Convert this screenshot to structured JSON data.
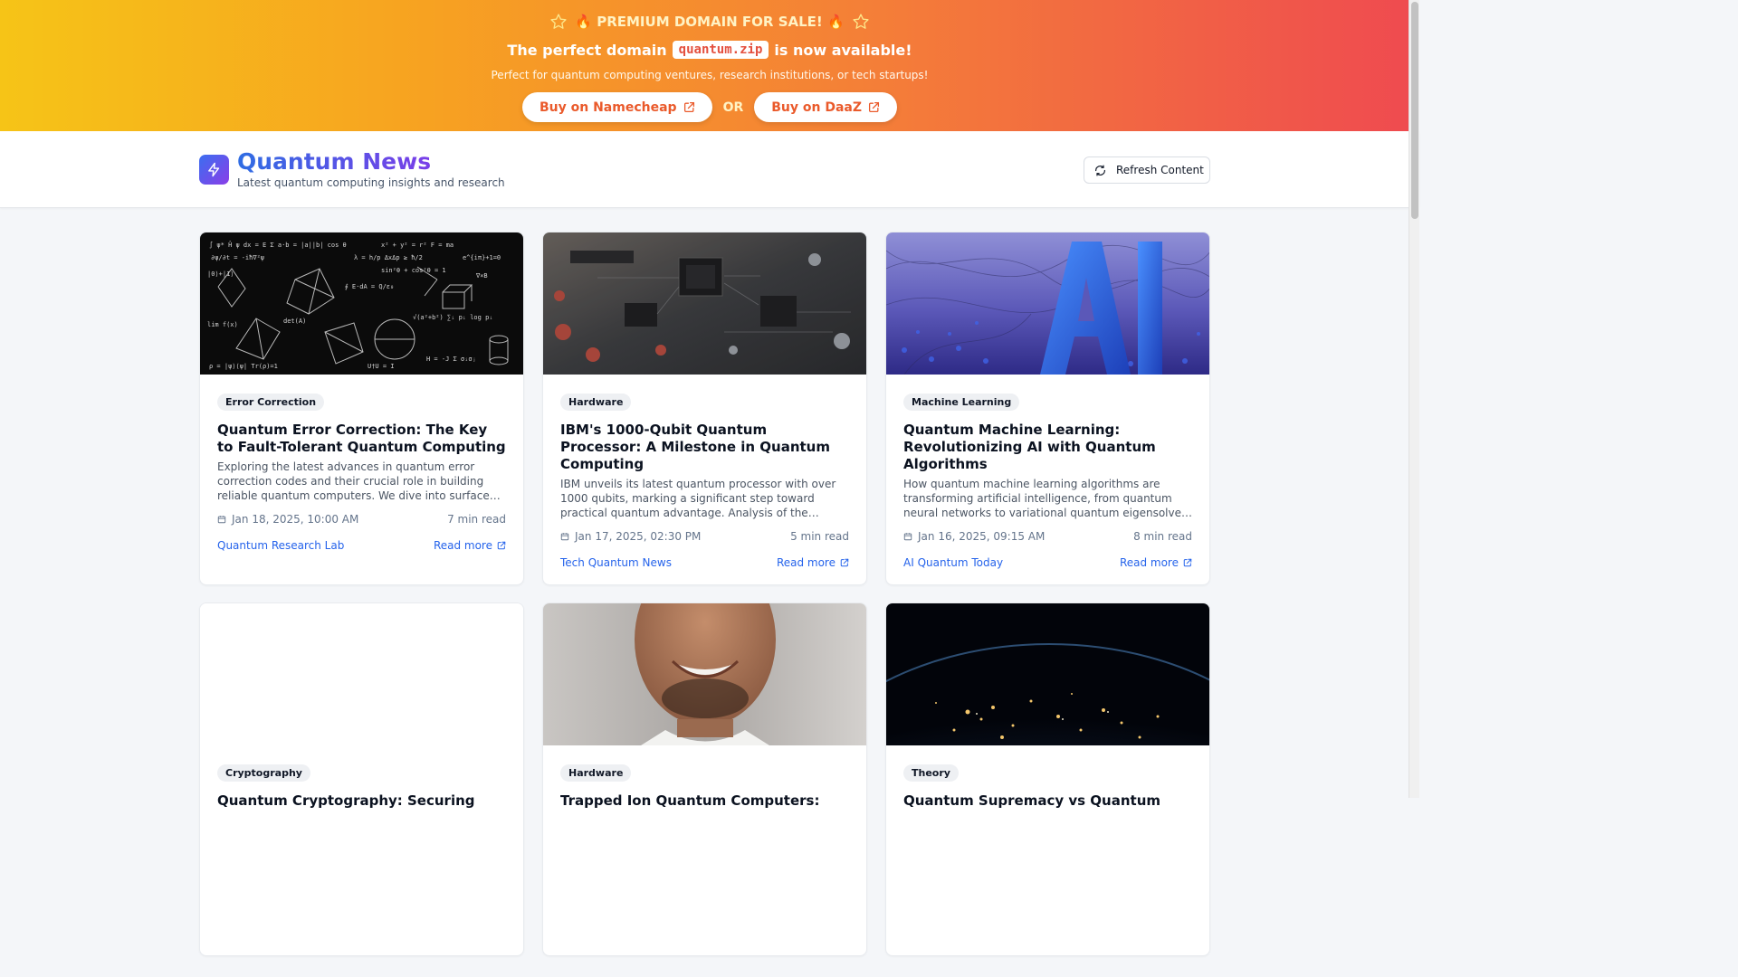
{
  "banner": {
    "title": "🔥 PREMIUM DOMAIN FOR SALE! 🔥",
    "subtitle_pre": "The perfect domain",
    "domain": "quantum.zip",
    "subtitle_post": "is now available!",
    "description": "Perfect for quantum computing ventures, research institutions, or tech startups!",
    "buy_namecheap": "Buy on Namecheap",
    "or_label": "OR",
    "buy_daaz": "Buy on DaaZ"
  },
  "header": {
    "title": "Quantum News",
    "tagline": "Latest quantum computing insights and research",
    "refresh_label": "Refresh Content"
  },
  "articles": [
    {
      "tag": "Error Correction",
      "title": "Quantum Error Correction: The Key to Fault-Tolerant Quantum Computing",
      "description": "Exploring the latest advances in quantum error correction codes and their crucial role in building reliable quantum computers. We dive into surface codes, topological approaches and more.",
      "date": "Jan 18, 2025, 10:00 AM",
      "read_time": "7 min read",
      "source": "Quantum Research Lab",
      "read_more": "Read more"
    },
    {
      "tag": "Hardware",
      "title": "IBM's 1000-Qubit Quantum Processor: A Milestone in Quantum Computing",
      "description": "IBM unveils its latest quantum processor with over 1000 qubits, marking a significant step toward practical quantum advantage. Analysis of the technical details and implications.",
      "date": "Jan 17, 2025, 02:30 PM",
      "read_time": "5 min read",
      "source": "Tech Quantum News",
      "read_more": "Read more"
    },
    {
      "tag": "Machine Learning",
      "title": "Quantum Machine Learning: Revolutionizing AI with Quantum Algorithms",
      "description": "How quantum machine learning algorithms are transforming artificial intelligence, from quantum neural networks to variational quantum eigensolvers and beyond.",
      "date": "Jan 16, 2025, 09:15 AM",
      "read_time": "8 min read",
      "source": "AI Quantum Today",
      "read_more": "Read more"
    },
    {
      "tag": "Cryptography",
      "title": "Quantum Cryptography: Securing",
      "description": "",
      "date": "",
      "read_time": "",
      "source": "",
      "read_more": ""
    },
    {
      "tag": "Hardware",
      "title": "Trapped Ion Quantum Computers:",
      "description": "",
      "date": "",
      "read_time": "",
      "source": "",
      "read_more": ""
    },
    {
      "tag": "Theory",
      "title": "Quantum Supremacy vs Quantum",
      "description": "",
      "date": "",
      "read_time": "",
      "source": "",
      "read_more": ""
    }
  ],
  "icons": {
    "star": "star-outline-icon",
    "external": "external-link-icon",
    "logo": "lightning-bolt-icon",
    "refresh": "refresh-icon",
    "calendar": "calendar-icon"
  },
  "colors": {
    "banner_start": "#f6c417",
    "banner_end": "#ef4a50",
    "brand_blue": "#2f6de3",
    "brand_purple": "#7a3ee8",
    "link": "#2563eb"
  }
}
